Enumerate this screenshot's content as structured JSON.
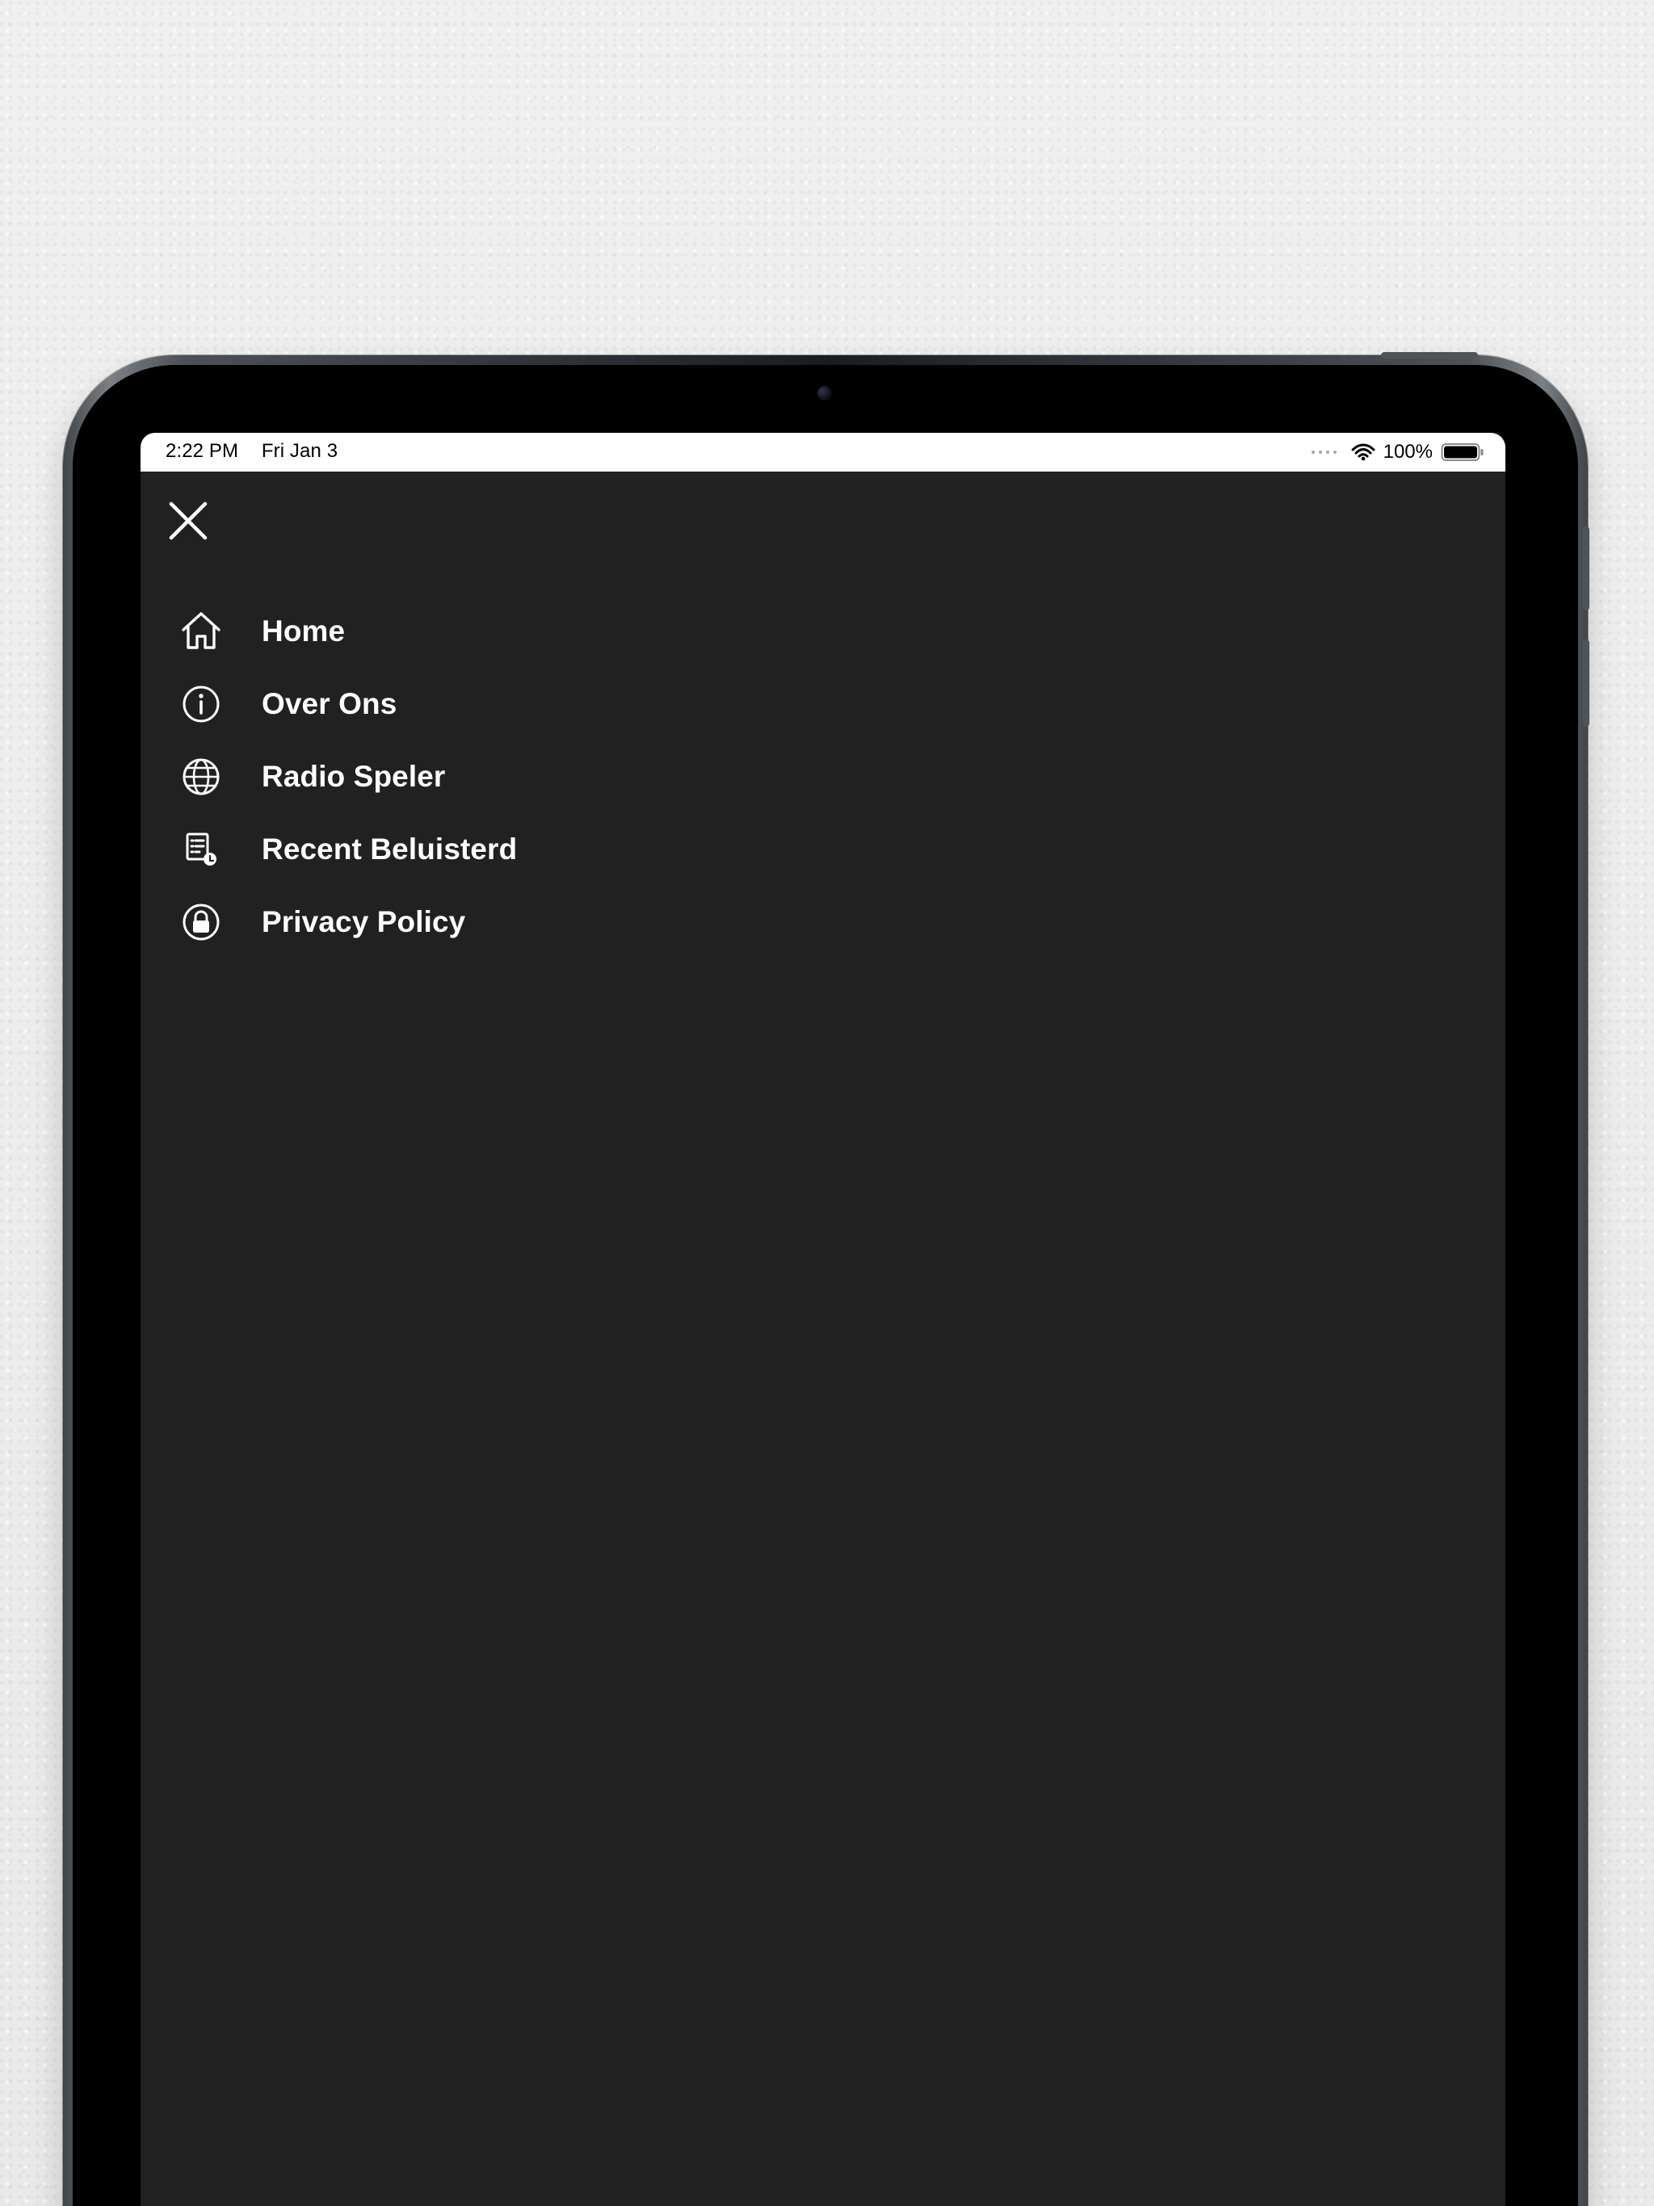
{
  "status_bar": {
    "time": "2:22 PM",
    "date": "Fri Jan 3",
    "battery_percent": "100%",
    "icons": [
      "signal-dots-icon",
      "wifi-icon",
      "battery-icon"
    ]
  },
  "menu": {
    "close_icon": "close-icon",
    "items": [
      {
        "label": "Home",
        "icon": "home-icon"
      },
      {
        "label": "Over Ons",
        "icon": "info-icon"
      },
      {
        "label": "Radio Speler",
        "icon": "globe-icon"
      },
      {
        "label": "Recent Beluisterd",
        "icon": "recent-list-icon"
      },
      {
        "label": "Privacy Policy",
        "icon": "lock-icon"
      }
    ]
  },
  "theme": {
    "background": "#212121",
    "text": "#ffffff",
    "status_bar_background": "#ffffff",
    "status_bar_text": "#000000"
  }
}
